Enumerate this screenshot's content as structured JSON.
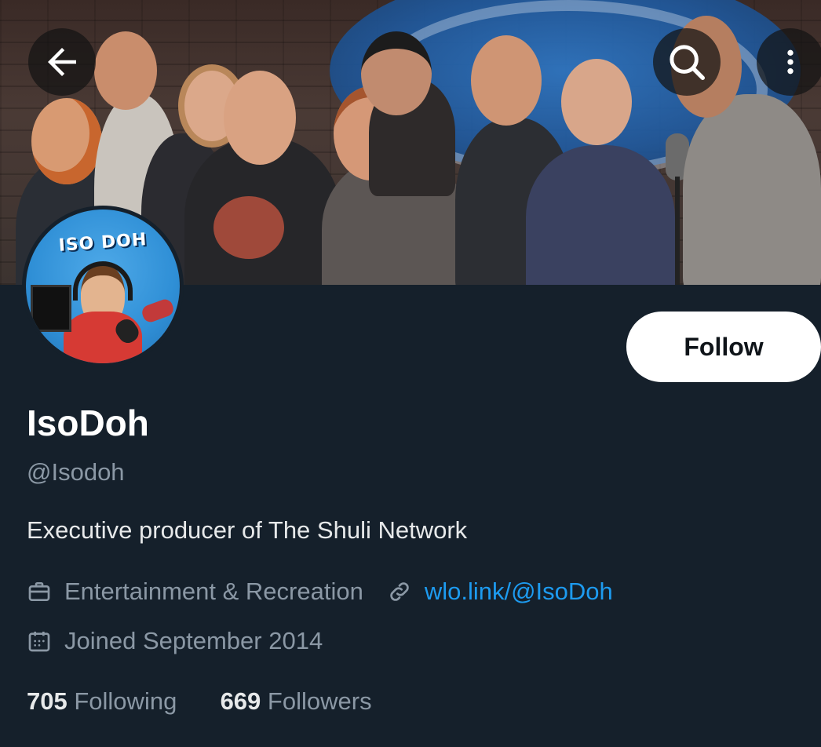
{
  "header": {
    "back_icon": "arrow-left-icon",
    "search_icon": "search-icon",
    "more_icon": "more-vertical-icon"
  },
  "profile": {
    "avatar_text": "ISO DOH",
    "display_name": "IsoDoh",
    "handle": "@Isodoh",
    "bio": "Executive producer of The Shuli Network",
    "category": "Entertainment & Recreation",
    "link": "wlo.link/@IsoDoh",
    "joined": "Joined September 2014",
    "following_count": "705",
    "following_label": "Following",
    "followers_count": "669",
    "followers_label": "Followers"
  },
  "actions": {
    "follow_label": "Follow"
  },
  "colors": {
    "background": "#15202b",
    "muted_text": "#8b98a5",
    "link": "#1d9bf0",
    "button_bg": "#ffffff"
  }
}
